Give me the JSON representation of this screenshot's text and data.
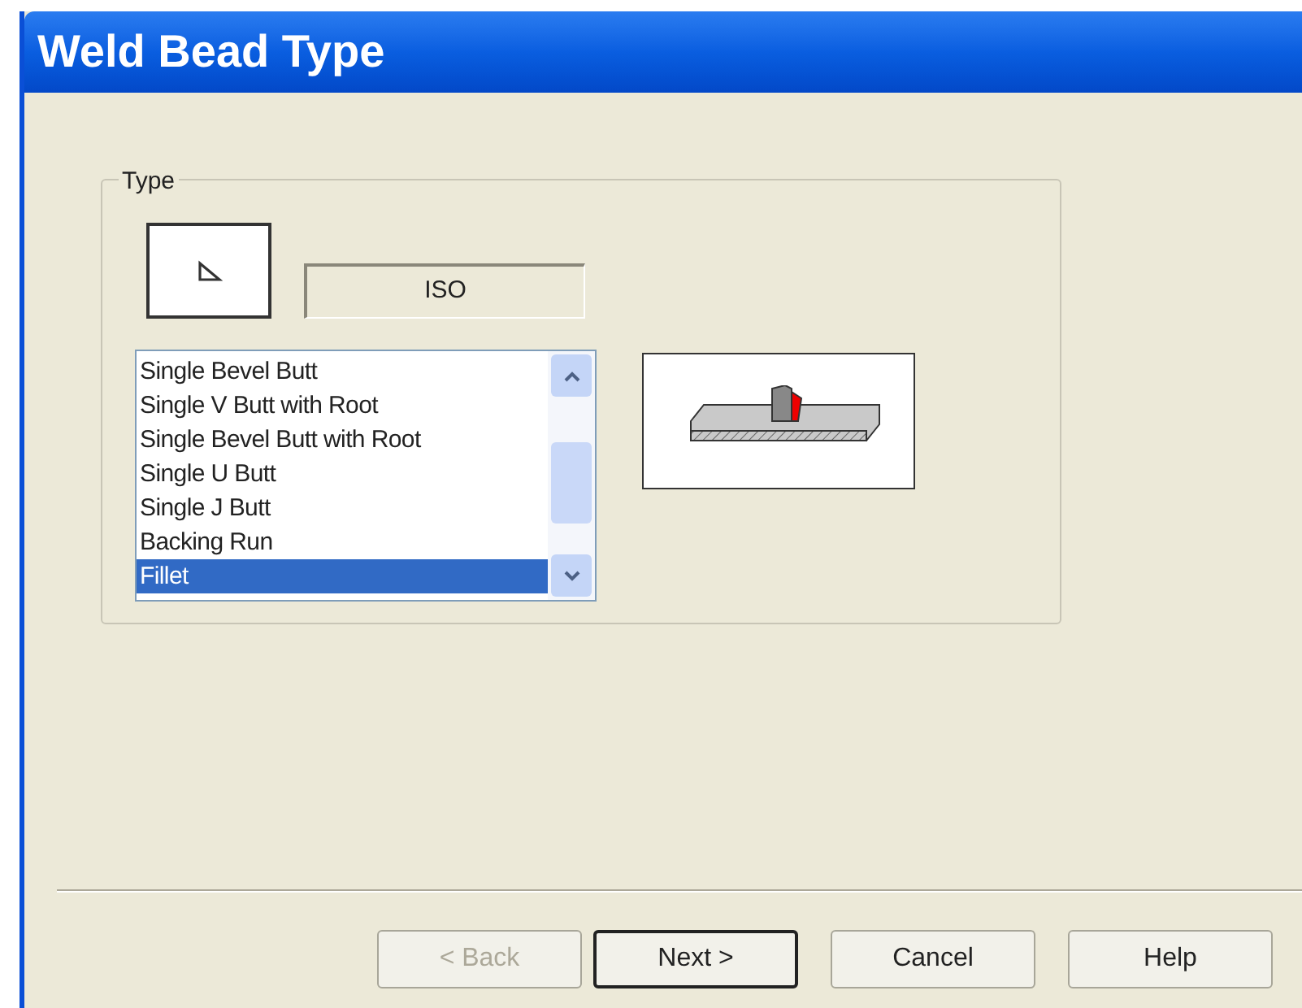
{
  "window": {
    "title": "Weld Bead Type"
  },
  "type_group": {
    "label": "Type",
    "standard": "ISO",
    "items": [
      {
        "label": "Single Bevel Butt",
        "selected": false
      },
      {
        "label": "Single V Butt with Root",
        "selected": false
      },
      {
        "label": "Single Bevel Butt with Root",
        "selected": false
      },
      {
        "label": "Single U Butt",
        "selected": false
      },
      {
        "label": "Single J Butt",
        "selected": false
      },
      {
        "label": "Backing Run",
        "selected": false
      },
      {
        "label": "Fillet",
        "selected": true
      }
    ]
  },
  "buttons": [
    {
      "label": "< Back",
      "disabled": true,
      "default": false
    },
    {
      "label": "Next >",
      "disabled": false,
      "default": true
    },
    {
      "label": "Cancel",
      "disabled": false,
      "default": false
    },
    {
      "label": "Help",
      "disabled": false,
      "default": false
    }
  ]
}
